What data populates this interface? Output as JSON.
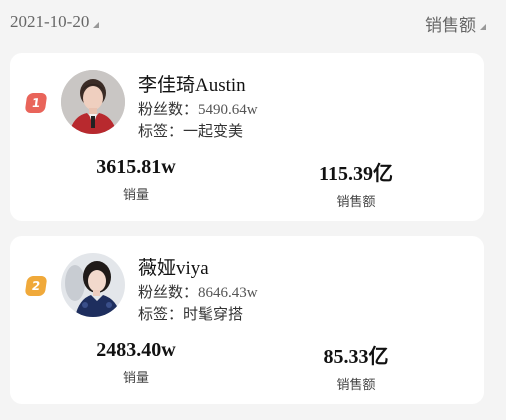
{
  "header": {
    "date": "2021-10-20",
    "sort_label": "销售额"
  },
  "cards": [
    {
      "rank": "1",
      "rank_color": "#e9645a",
      "name": "李佳琦Austin",
      "fans_label": "粉丝数：",
      "fans_value": "5490.64w",
      "tags_label": "标签：",
      "tags_value": "一起变美",
      "sales_volume": "3615.81w",
      "sales_volume_label": "销量",
      "sales_amount": "115.39亿",
      "sales_amount_label": "销售额"
    },
    {
      "rank": "2",
      "rank_color": "#f0a93a",
      "name": "薇娅viya",
      "fans_label": "粉丝数：",
      "fans_value": "8646.43w",
      "tags_label": "标签：",
      "tags_value": "时髦穿搭",
      "sales_volume": "2483.40w",
      "sales_volume_label": "销量",
      "sales_amount": "85.33亿",
      "sales_amount_label": "销售额"
    }
  ]
}
